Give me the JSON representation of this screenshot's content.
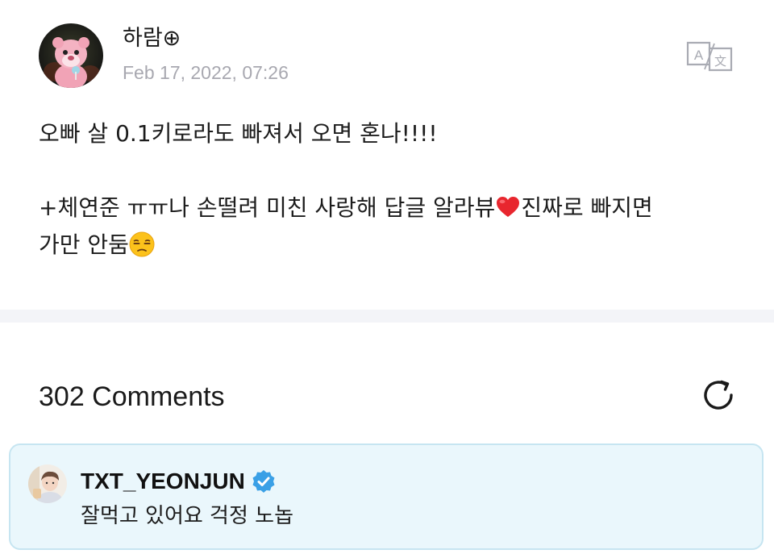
{
  "post": {
    "author": "하람⊕",
    "timestamp": "Feb 17, 2022, 07:26",
    "line1": "오빠 살 0.1키로라도 빠져서 오면 혼나!!!!",
    "line2_a": "+체연준 ㅠㅠ나 손떨려 미친 사랑해 답글 알라뷰",
    "line2_b": "진짜로 빠지면",
    "line3_a": "가만 안둠",
    "heart_emoji": "heart-emoji",
    "unamused_emoji": "unamused-face-emoji"
  },
  "comments": {
    "header": "302 Comments",
    "refresh_icon": "refresh-icon",
    "items": [
      {
        "author": "TXT_YEONJUN",
        "verified": true,
        "text": "잘먹고 있어요 걱정 노놉"
      }
    ]
  },
  "colors": {
    "timestamp": "#a8a8b0",
    "comment_card_bg": "#eaf7fc",
    "comment_card_border": "#c6e5f1",
    "verified_badge": "#3aa0e6",
    "divider": "#f3f4f8"
  },
  "icons": {
    "translate": "translate-icon"
  }
}
